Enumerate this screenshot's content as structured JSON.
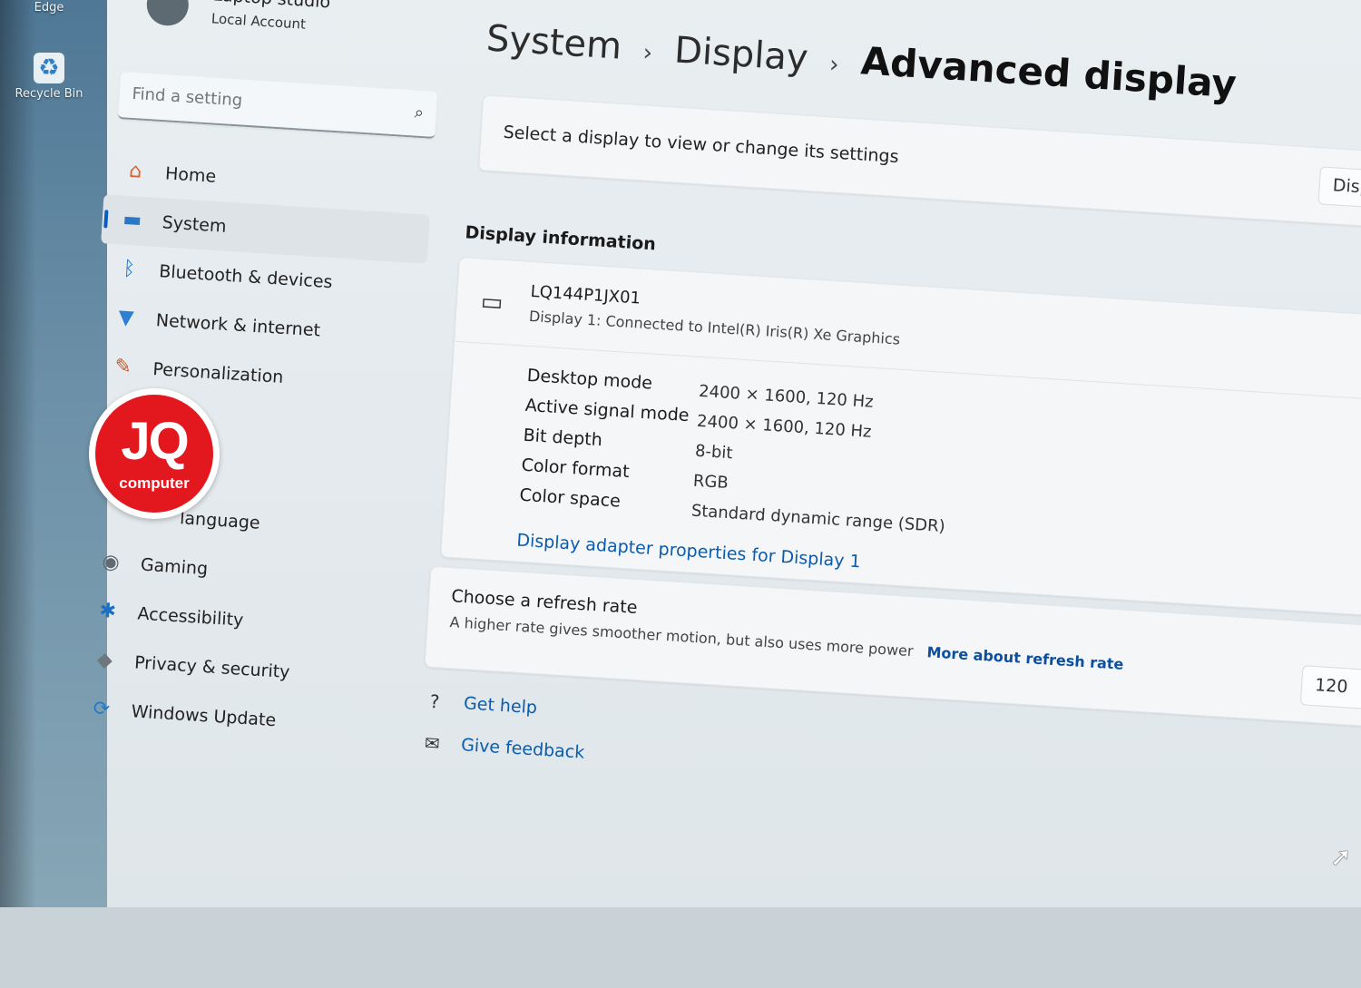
{
  "desktop": {
    "icons": [
      {
        "label": "Microsoft Edge",
        "icon": "edge-icon"
      },
      {
        "label": "Recycle Bin",
        "icon": "recycle-bin-icon"
      }
    ]
  },
  "account": {
    "name": "Laptop studio",
    "type": "Local Account"
  },
  "search": {
    "placeholder": "Find a setting"
  },
  "sidebar": {
    "items": [
      {
        "label": "Home",
        "icon": "home-icon"
      },
      {
        "label": "System",
        "icon": "system-icon",
        "active": true
      },
      {
        "label": "Bluetooth & devices",
        "icon": "bluetooth-icon"
      },
      {
        "label": "Network & internet",
        "icon": "wifi-icon"
      },
      {
        "label": "Personalization",
        "icon": "brush-icon"
      },
      {
        "label": "language",
        "icon": "language-icon"
      },
      {
        "label": "Gaming",
        "icon": "gamepad-icon"
      },
      {
        "label": "Accessibility",
        "icon": "accessibility-icon"
      },
      {
        "label": "Privacy & security",
        "icon": "shield-icon"
      },
      {
        "label": "Windows Update",
        "icon": "update-icon"
      }
    ]
  },
  "breadcrumb": {
    "items": [
      "System",
      "Display",
      "Advanced display"
    ]
  },
  "select_display": {
    "text": "Select a display to view or change its settings",
    "dropdown_value": "Disp"
  },
  "display_info": {
    "section_title": "Display information",
    "monitor_name": "LQ144P1JX01",
    "monitor_subtitle": "Display 1: Connected to Intel(R) Iris(R) Xe Graphics",
    "specs": [
      {
        "label": "Desktop mode",
        "value": "2400 × 1600, 120 Hz"
      },
      {
        "label": "Active signal mode",
        "value": "2400 × 1600, 120 Hz"
      },
      {
        "label": "Bit depth",
        "value": "8-bit"
      },
      {
        "label": "Color format",
        "value": "RGB"
      },
      {
        "label": "Color space",
        "value": "Standard dynamic range (SDR)"
      }
    ],
    "adapter_link": "Display adapter properties for Display 1"
  },
  "refresh": {
    "title": "Choose a refresh rate",
    "subtitle": "A higher rate gives smoother motion, but also uses more power",
    "link": "More about refresh rate",
    "value": "120"
  },
  "help": {
    "get_help": "Get help",
    "give_feedback": "Give feedback"
  },
  "watermark": {
    "big": "JQ",
    "small": "computer"
  },
  "colors": {
    "accent": "#0a5cc0",
    "link": "#0b5cad",
    "logo_red": "#e3181f"
  }
}
